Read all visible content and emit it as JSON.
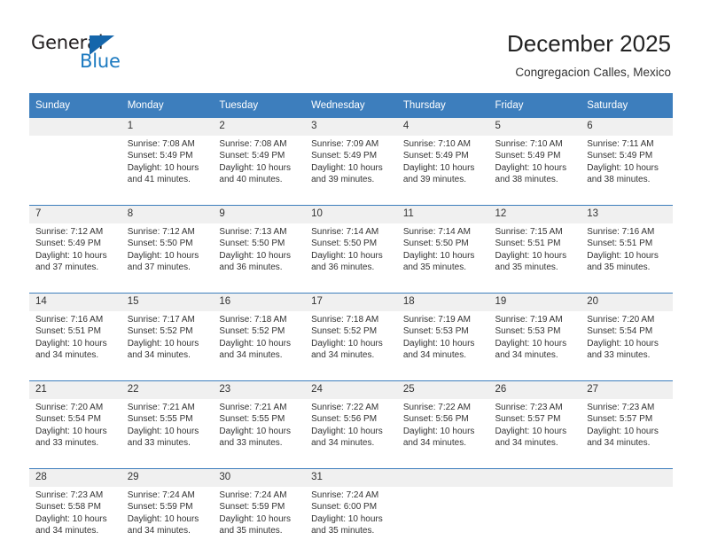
{
  "brand": {
    "name_part1": "General",
    "name_part2": "Blue"
  },
  "header": {
    "title": "December 2025",
    "subtitle": "Congregacion Calles, Mexico"
  },
  "weekdays": [
    "Sunday",
    "Monday",
    "Tuesday",
    "Wednesday",
    "Thursday",
    "Friday",
    "Saturday"
  ],
  "colors": {
    "header_blue": "#3d7ebd",
    "brand_blue": "#1c7ac0",
    "daynum_bg": "#f0f0f0"
  },
  "weeks": [
    [
      {
        "day": "",
        "sunrise": "",
        "sunset": "",
        "daylight_1": "",
        "daylight_2": ""
      },
      {
        "day": "1",
        "sunrise": "Sunrise: 7:08 AM",
        "sunset": "Sunset: 5:49 PM",
        "daylight_1": "Daylight: 10 hours",
        "daylight_2": "and 41 minutes."
      },
      {
        "day": "2",
        "sunrise": "Sunrise: 7:08 AM",
        "sunset": "Sunset: 5:49 PM",
        "daylight_1": "Daylight: 10 hours",
        "daylight_2": "and 40 minutes."
      },
      {
        "day": "3",
        "sunrise": "Sunrise: 7:09 AM",
        "sunset": "Sunset: 5:49 PM",
        "daylight_1": "Daylight: 10 hours",
        "daylight_2": "and 39 minutes."
      },
      {
        "day": "4",
        "sunrise": "Sunrise: 7:10 AM",
        "sunset": "Sunset: 5:49 PM",
        "daylight_1": "Daylight: 10 hours",
        "daylight_2": "and 39 minutes."
      },
      {
        "day": "5",
        "sunrise": "Sunrise: 7:10 AM",
        "sunset": "Sunset: 5:49 PM",
        "daylight_1": "Daylight: 10 hours",
        "daylight_2": "and 38 minutes."
      },
      {
        "day": "6",
        "sunrise": "Sunrise: 7:11 AM",
        "sunset": "Sunset: 5:49 PM",
        "daylight_1": "Daylight: 10 hours",
        "daylight_2": "and 38 minutes."
      }
    ],
    [
      {
        "day": "7",
        "sunrise": "Sunrise: 7:12 AM",
        "sunset": "Sunset: 5:49 PM",
        "daylight_1": "Daylight: 10 hours",
        "daylight_2": "and 37 minutes."
      },
      {
        "day": "8",
        "sunrise": "Sunrise: 7:12 AM",
        "sunset": "Sunset: 5:50 PM",
        "daylight_1": "Daylight: 10 hours",
        "daylight_2": "and 37 minutes."
      },
      {
        "day": "9",
        "sunrise": "Sunrise: 7:13 AM",
        "sunset": "Sunset: 5:50 PM",
        "daylight_1": "Daylight: 10 hours",
        "daylight_2": "and 36 minutes."
      },
      {
        "day": "10",
        "sunrise": "Sunrise: 7:14 AM",
        "sunset": "Sunset: 5:50 PM",
        "daylight_1": "Daylight: 10 hours",
        "daylight_2": "and 36 minutes."
      },
      {
        "day": "11",
        "sunrise": "Sunrise: 7:14 AM",
        "sunset": "Sunset: 5:50 PM",
        "daylight_1": "Daylight: 10 hours",
        "daylight_2": "and 35 minutes."
      },
      {
        "day": "12",
        "sunrise": "Sunrise: 7:15 AM",
        "sunset": "Sunset: 5:51 PM",
        "daylight_1": "Daylight: 10 hours",
        "daylight_2": "and 35 minutes."
      },
      {
        "day": "13",
        "sunrise": "Sunrise: 7:16 AM",
        "sunset": "Sunset: 5:51 PM",
        "daylight_1": "Daylight: 10 hours",
        "daylight_2": "and 35 minutes."
      }
    ],
    [
      {
        "day": "14",
        "sunrise": "Sunrise: 7:16 AM",
        "sunset": "Sunset: 5:51 PM",
        "daylight_1": "Daylight: 10 hours",
        "daylight_2": "and 34 minutes."
      },
      {
        "day": "15",
        "sunrise": "Sunrise: 7:17 AM",
        "sunset": "Sunset: 5:52 PM",
        "daylight_1": "Daylight: 10 hours",
        "daylight_2": "and 34 minutes."
      },
      {
        "day": "16",
        "sunrise": "Sunrise: 7:18 AM",
        "sunset": "Sunset: 5:52 PM",
        "daylight_1": "Daylight: 10 hours",
        "daylight_2": "and 34 minutes."
      },
      {
        "day": "17",
        "sunrise": "Sunrise: 7:18 AM",
        "sunset": "Sunset: 5:52 PM",
        "daylight_1": "Daylight: 10 hours",
        "daylight_2": "and 34 minutes."
      },
      {
        "day": "18",
        "sunrise": "Sunrise: 7:19 AM",
        "sunset": "Sunset: 5:53 PM",
        "daylight_1": "Daylight: 10 hours",
        "daylight_2": "and 34 minutes."
      },
      {
        "day": "19",
        "sunrise": "Sunrise: 7:19 AM",
        "sunset": "Sunset: 5:53 PM",
        "daylight_1": "Daylight: 10 hours",
        "daylight_2": "and 34 minutes."
      },
      {
        "day": "20",
        "sunrise": "Sunrise: 7:20 AM",
        "sunset": "Sunset: 5:54 PM",
        "daylight_1": "Daylight: 10 hours",
        "daylight_2": "and 33 minutes."
      }
    ],
    [
      {
        "day": "21",
        "sunrise": "Sunrise: 7:20 AM",
        "sunset": "Sunset: 5:54 PM",
        "daylight_1": "Daylight: 10 hours",
        "daylight_2": "and 33 minutes."
      },
      {
        "day": "22",
        "sunrise": "Sunrise: 7:21 AM",
        "sunset": "Sunset: 5:55 PM",
        "daylight_1": "Daylight: 10 hours",
        "daylight_2": "and 33 minutes."
      },
      {
        "day": "23",
        "sunrise": "Sunrise: 7:21 AM",
        "sunset": "Sunset: 5:55 PM",
        "daylight_1": "Daylight: 10 hours",
        "daylight_2": "and 33 minutes."
      },
      {
        "day": "24",
        "sunrise": "Sunrise: 7:22 AM",
        "sunset": "Sunset: 5:56 PM",
        "daylight_1": "Daylight: 10 hours",
        "daylight_2": "and 34 minutes."
      },
      {
        "day": "25",
        "sunrise": "Sunrise: 7:22 AM",
        "sunset": "Sunset: 5:56 PM",
        "daylight_1": "Daylight: 10 hours",
        "daylight_2": "and 34 minutes."
      },
      {
        "day": "26",
        "sunrise": "Sunrise: 7:23 AM",
        "sunset": "Sunset: 5:57 PM",
        "daylight_1": "Daylight: 10 hours",
        "daylight_2": "and 34 minutes."
      },
      {
        "day": "27",
        "sunrise": "Sunrise: 7:23 AM",
        "sunset": "Sunset: 5:57 PM",
        "daylight_1": "Daylight: 10 hours",
        "daylight_2": "and 34 minutes."
      }
    ],
    [
      {
        "day": "28",
        "sunrise": "Sunrise: 7:23 AM",
        "sunset": "Sunset: 5:58 PM",
        "daylight_1": "Daylight: 10 hours",
        "daylight_2": "and 34 minutes."
      },
      {
        "day": "29",
        "sunrise": "Sunrise: 7:24 AM",
        "sunset": "Sunset: 5:59 PM",
        "daylight_1": "Daylight: 10 hours",
        "daylight_2": "and 34 minutes."
      },
      {
        "day": "30",
        "sunrise": "Sunrise: 7:24 AM",
        "sunset": "Sunset: 5:59 PM",
        "daylight_1": "Daylight: 10 hours",
        "daylight_2": "and 35 minutes."
      },
      {
        "day": "31",
        "sunrise": "Sunrise: 7:24 AM",
        "sunset": "Sunset: 6:00 PM",
        "daylight_1": "Daylight: 10 hours",
        "daylight_2": "and 35 minutes."
      },
      {
        "day": "",
        "sunrise": "",
        "sunset": "",
        "daylight_1": "",
        "daylight_2": ""
      },
      {
        "day": "",
        "sunrise": "",
        "sunset": "",
        "daylight_1": "",
        "daylight_2": ""
      },
      {
        "day": "",
        "sunrise": "",
        "sunset": "",
        "daylight_1": "",
        "daylight_2": ""
      }
    ]
  ]
}
